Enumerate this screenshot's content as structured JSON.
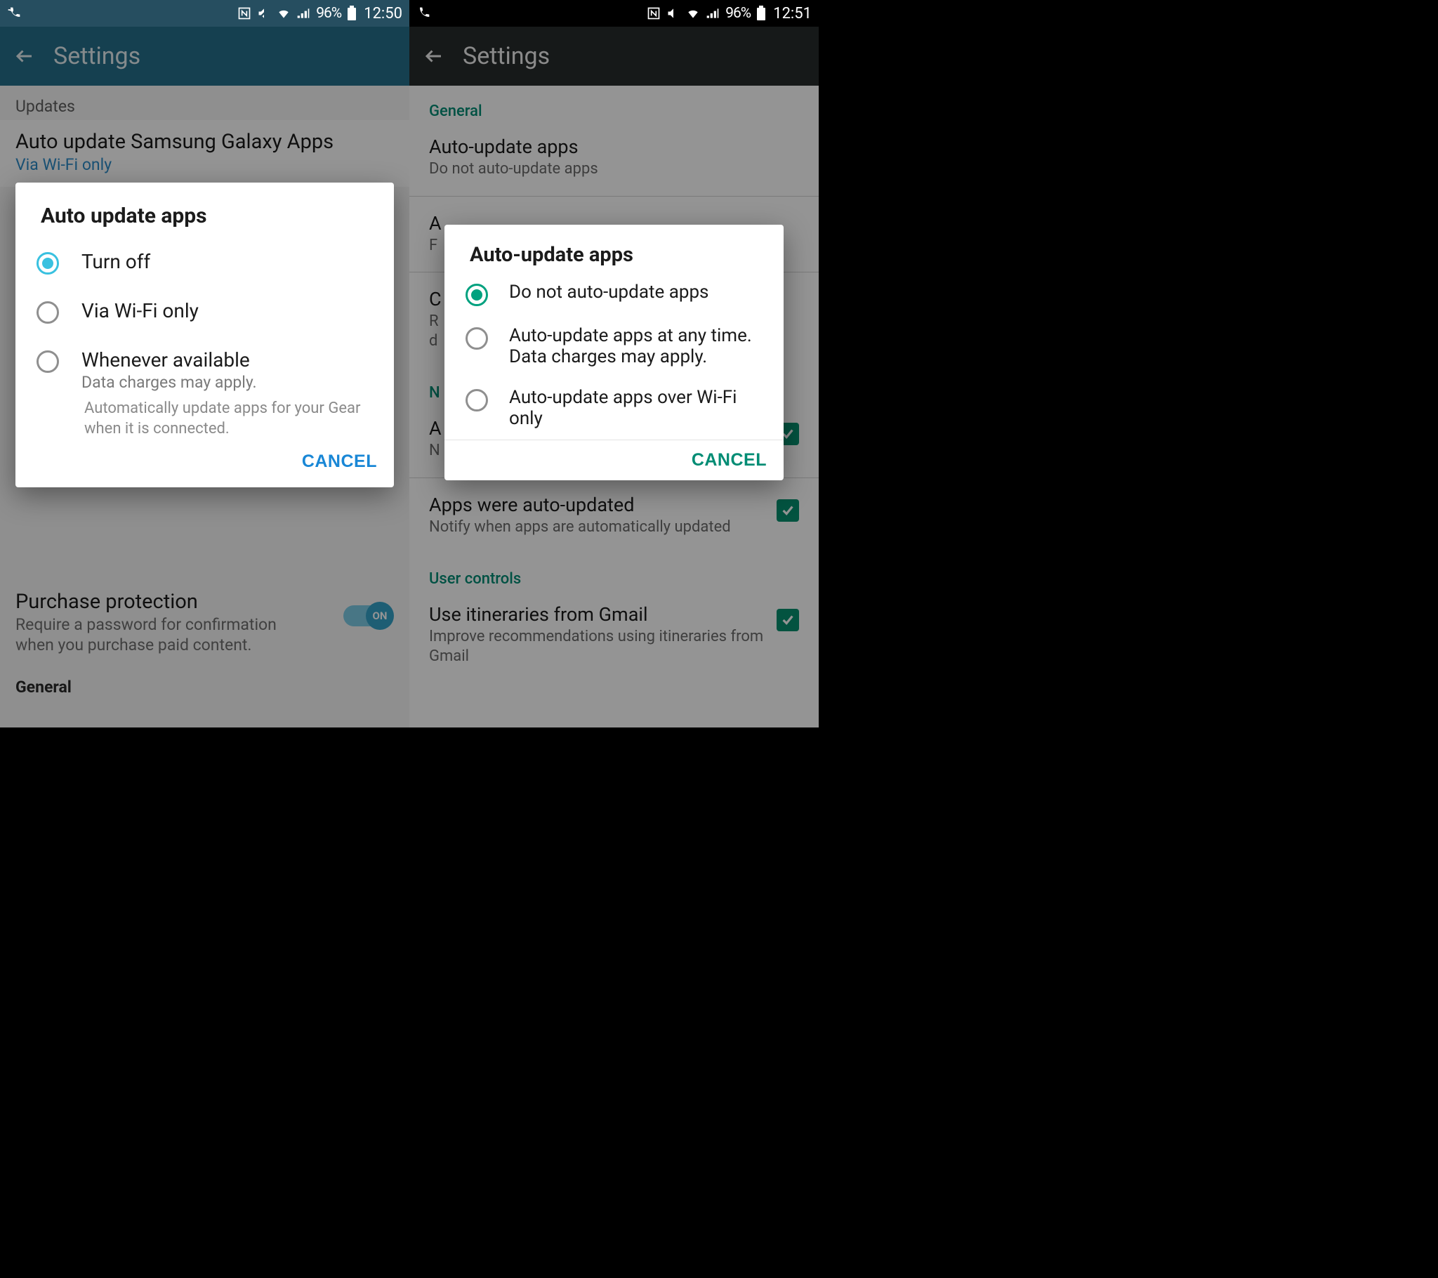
{
  "left": {
    "status": {
      "battery_pct": "96%",
      "time": "12:50"
    },
    "appbar_title": "Settings",
    "section_updates": "Updates",
    "auto_update_title": "Auto update Samsung Galaxy Apps",
    "auto_update_sub": "Via Wi-Fi only",
    "purchase_title": "Purchase protection",
    "purchase_sub": "Require a password for confirmation when you purchase paid content.",
    "toggle_on": "ON",
    "section_general": "General",
    "dialog": {
      "title": "Auto update apps",
      "options": [
        {
          "label": "Turn off",
          "sub": "",
          "selected": true
        },
        {
          "label": "Via Wi-Fi only",
          "sub": "",
          "selected": false
        },
        {
          "label": "Whenever available",
          "sub": "Data charges may apply.",
          "selected": false
        }
      ],
      "footnote": "Automatically update apps for your Gear when it is connected.",
      "cancel": "CANCEL"
    }
  },
  "right": {
    "status": {
      "battery_pct": "96%",
      "time": "12:51"
    },
    "appbar_title": "Settings",
    "section_general": "General",
    "auto_update_title": "Auto-update apps",
    "auto_update_sub": "Do not auto-update apps",
    "item_ac_title": "A",
    "item_ac_sub": "F",
    "item_cl_title": "C",
    "item_cl_sub_line1": "R",
    "item_cl_sub_line2": "d",
    "section_notifications": "N",
    "item_ap_title": "A",
    "item_ap_sub": "N",
    "apps_updated_title": "Apps were auto-updated",
    "apps_updated_sub": "Notify when apps are automatically updated",
    "section_user_controls": "User controls",
    "gmail_title": "Use itineraries from Gmail",
    "gmail_sub": "Improve recommendations using itineraries from Gmail",
    "dialog": {
      "title": "Auto-update apps",
      "options": [
        {
          "label": "Do not auto-update apps",
          "selected": true
        },
        {
          "label": "Auto-update apps at any time. Data charges may apply.",
          "selected": false
        },
        {
          "label": "Auto-update apps over Wi-Fi only",
          "selected": false
        }
      ],
      "cancel": "CANCEL"
    }
  }
}
